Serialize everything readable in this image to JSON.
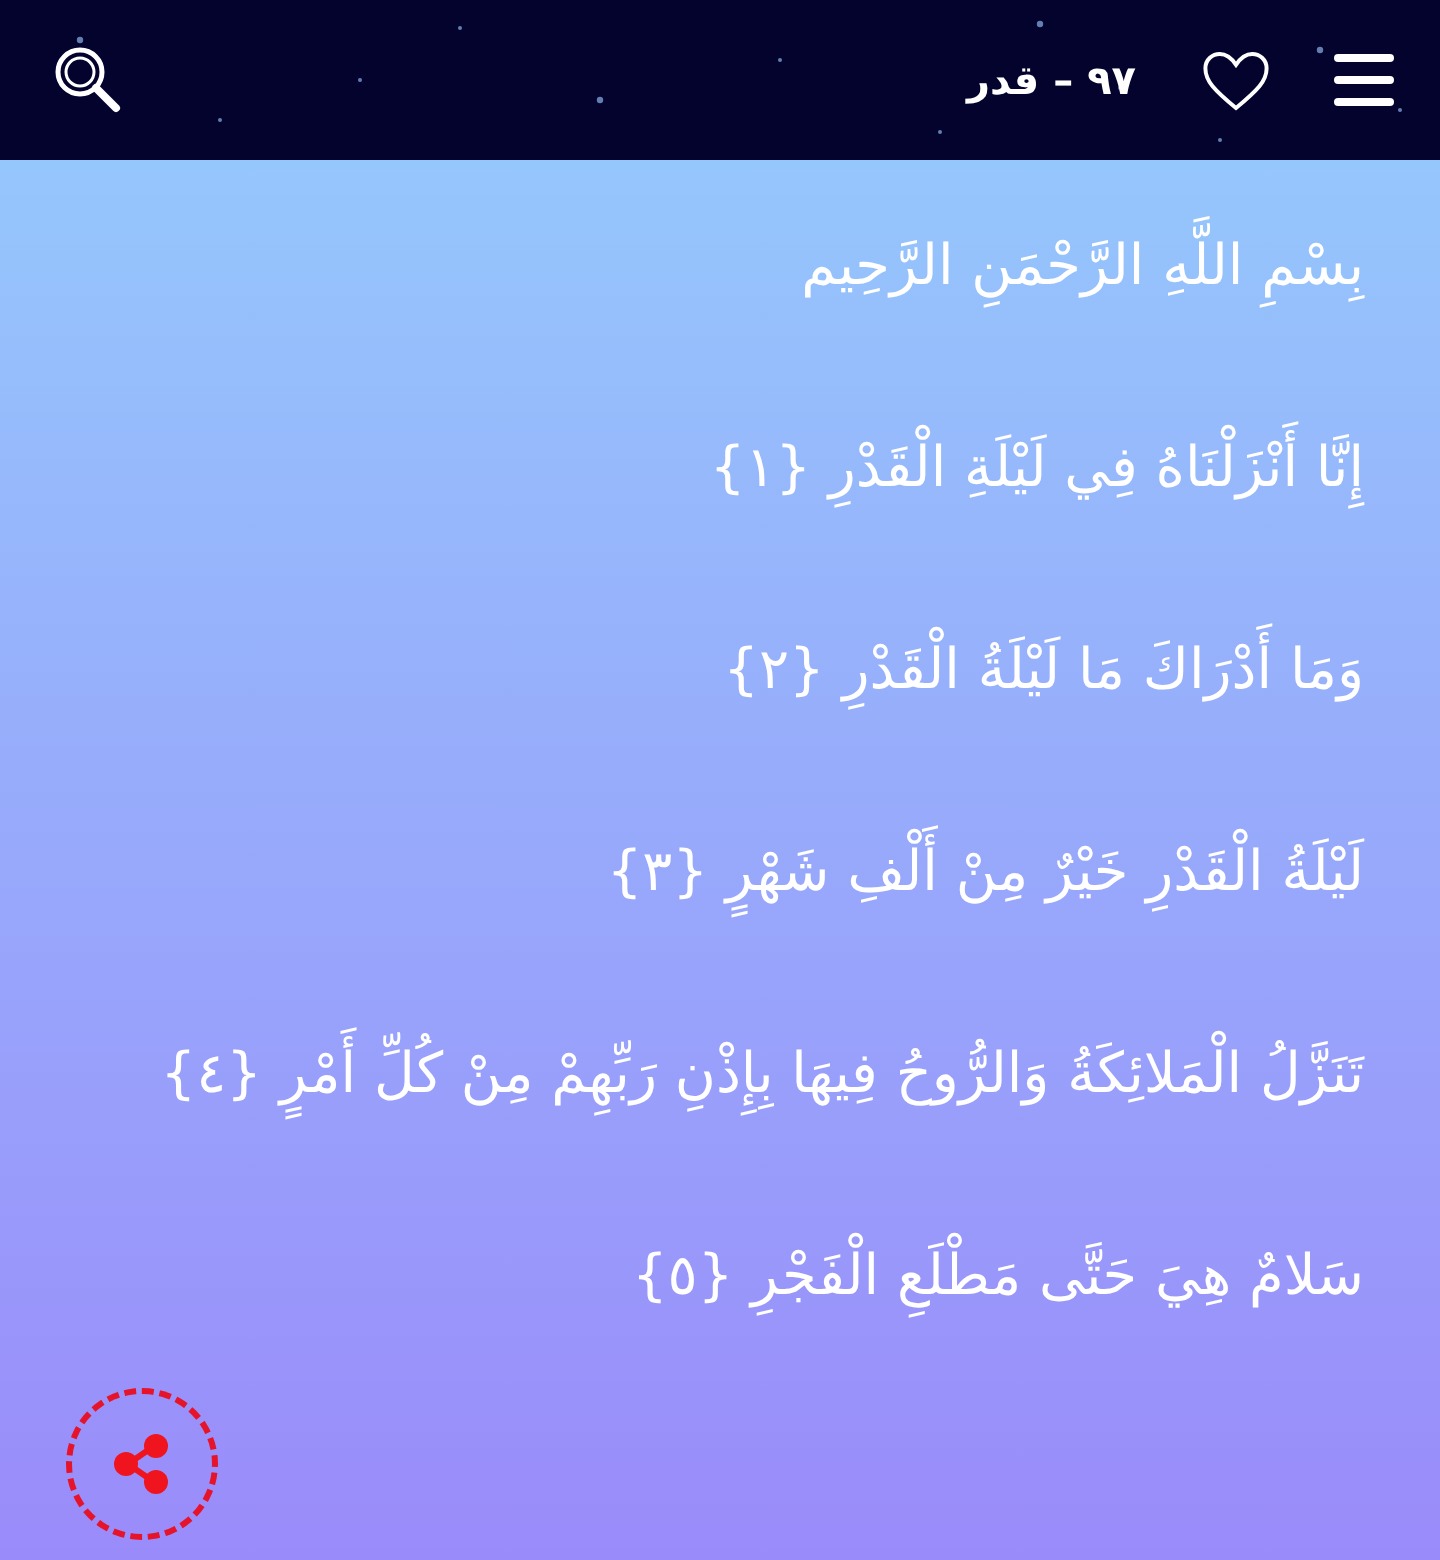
{
  "header": {
    "title": "٩٧ – قدر"
  },
  "verses": [
    {
      "text": "بِسْمِ اللَّهِ الرَّحْمَنِ الرَّحِيم"
    },
    {
      "text": "إِنَّا أَنْزَلْنَاهُ فِي لَيْلَةِ الْقَدْرِ {١}"
    },
    {
      "text": "وَمَا أَدْرَاكَ مَا لَيْلَةُ الْقَدْرِ {٢}"
    },
    {
      "text": "لَيْلَةُ الْقَدْرِ خَيْرٌ مِنْ أَلْفِ شَهْرٍ {٣}"
    },
    {
      "text": "تَنَزَّلُ الْمَلائِكَةُ وَالرُّوحُ فِيهَا بِإِذْنِ رَبِّهِمْ مِنْ كُلِّ أَمْرٍ {٤}"
    },
    {
      "text": "سَلامٌ هِيَ حَتَّى مَطْلَعِ الْفَجْرِ {٥}"
    }
  ]
}
